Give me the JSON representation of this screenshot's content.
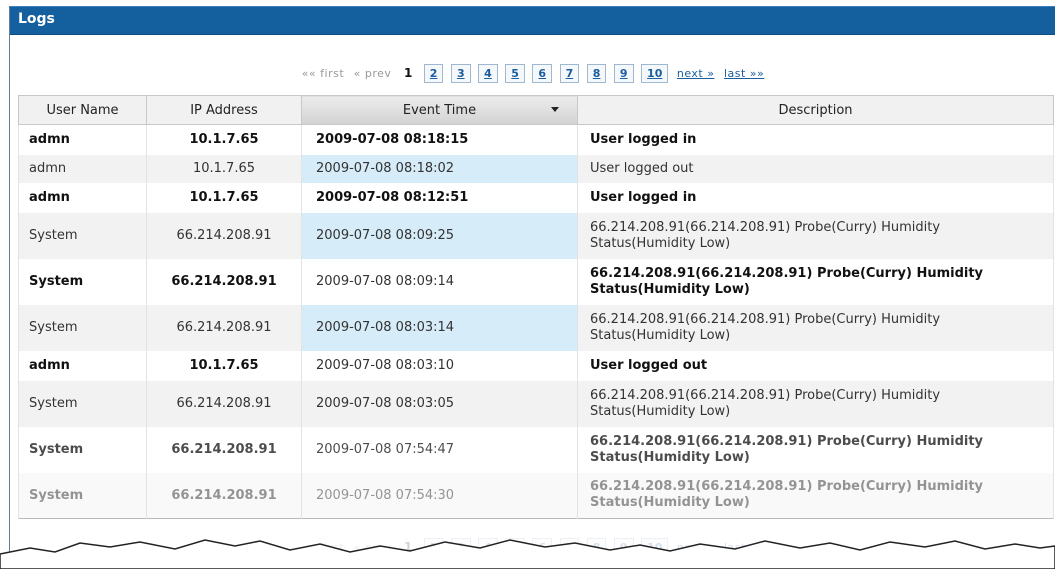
{
  "panel": {
    "title": "Logs"
  },
  "pagination": {
    "first_label": "«« first",
    "prev_label": "« prev",
    "current_page": "1",
    "pages": [
      "2",
      "3",
      "4",
      "5",
      "6",
      "7",
      "8",
      "9",
      "10"
    ],
    "next_label": "next »",
    "last_label": "last »»"
  },
  "table": {
    "columns": [
      "User Name",
      "IP Address",
      "Event Time",
      "Description"
    ],
    "sorted_column": "Event Time",
    "rows": [
      {
        "user": "admn",
        "ip": "10.1.7.65",
        "time": "2009-07-08 08:18:15",
        "desc1": "User logged in",
        "desc2": ""
      },
      {
        "user": "admn",
        "ip": "10.1.7.65",
        "time": "2009-07-08 08:18:02",
        "desc1": "User logged out",
        "desc2": ""
      },
      {
        "user": "admn",
        "ip": "10.1.7.65",
        "time": "2009-07-08 08:12:51",
        "desc1": "User logged in",
        "desc2": ""
      },
      {
        "user": "System",
        "ip": "66.214.208.91",
        "time": "2009-07-08 08:09:25",
        "desc1": "66.214.208.91(66.214.208.91) Probe(Curry) Humidity",
        "desc2": "Status(Humidity Low)"
      },
      {
        "user": "System",
        "ip": "66.214.208.91",
        "time": "2009-07-08 08:09:14",
        "desc1": "66.214.208.91(66.214.208.91) Probe(Curry) Humidity",
        "desc2": "Status(Humidity Low)"
      },
      {
        "user": "System",
        "ip": "66.214.208.91",
        "time": "2009-07-08 08:03:14",
        "desc1": "66.214.208.91(66.214.208.91) Probe(Curry) Humidity",
        "desc2": "Status(Humidity Low)"
      },
      {
        "user": "admn",
        "ip": "10.1.7.65",
        "time": "2009-07-08 08:03:10",
        "desc1": "User logged out",
        "desc2": ""
      },
      {
        "user": "System",
        "ip": "66.214.208.91",
        "time": "2009-07-08 08:03:05",
        "desc1": "66.214.208.91(66.214.208.91) Probe(Curry) Humidity",
        "desc2": "Status(Humidity Low)"
      },
      {
        "user": "System",
        "ip": "66.214.208.91",
        "time": "2009-07-08 07:54:47",
        "desc1": "66.214.208.91(66.214.208.91) Probe(Curry) Humidity",
        "desc2": "Status(Humidity Low)"
      },
      {
        "user": "System",
        "ip": "66.214.208.91",
        "time": "2009-07-08 07:54:30",
        "desc1": "66.214.208.91(66.214.208.91) Probe(Curry) Humidity",
        "desc2": "Status(Humidity Low)"
      }
    ]
  },
  "colors": {
    "title_bar": "#14609f",
    "link": "#1a5ea0",
    "row_highlight": "#d6ecf8"
  }
}
